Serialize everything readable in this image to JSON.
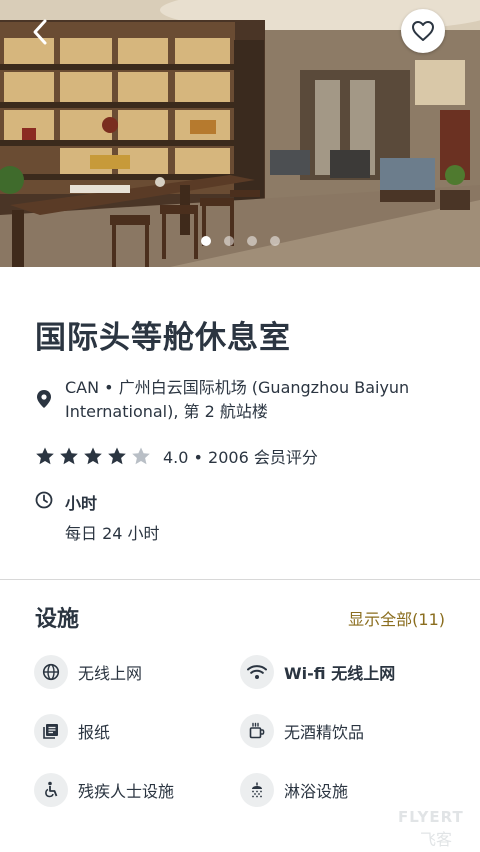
{
  "header": {
    "back_icon": "chevron-left-icon",
    "favorite_icon": "heart-outline-icon",
    "carousel": {
      "total": 4,
      "active_index": 0
    }
  },
  "lounge": {
    "title": "国际头等舱休息室",
    "location": "CAN • 广州白云国际机场 (Guangzhou Baiyun International), 第 2 航站楼",
    "rating": {
      "stars": 4,
      "max": 5,
      "text": "4.0 • 2006 会员评分"
    },
    "hours_label": "小时",
    "hours_value": "每日 24 小时"
  },
  "facilities": {
    "title": "设施",
    "show_all": "显示全部(11)",
    "items": [
      {
        "label": "无线上网",
        "icon": "globe-icon"
      },
      {
        "label": "Wi-fi 无线上网",
        "icon": "wifi-icon"
      },
      {
        "label": "报纸",
        "icon": "newspaper-icon"
      },
      {
        "label": "无酒精饮品",
        "icon": "coffee-cup-icon"
      },
      {
        "label": "残疾人士设施",
        "icon": "accessible-icon"
      },
      {
        "label": "淋浴设施",
        "icon": "shower-icon"
      }
    ]
  },
  "watermark": {
    "line1": "FLYERT",
    "line2": "飞客"
  },
  "colors": {
    "text": "#2b3541",
    "accent": "#8a6d1e",
    "star_on": "#2b3541",
    "star_off": "#b9bfc6"
  }
}
